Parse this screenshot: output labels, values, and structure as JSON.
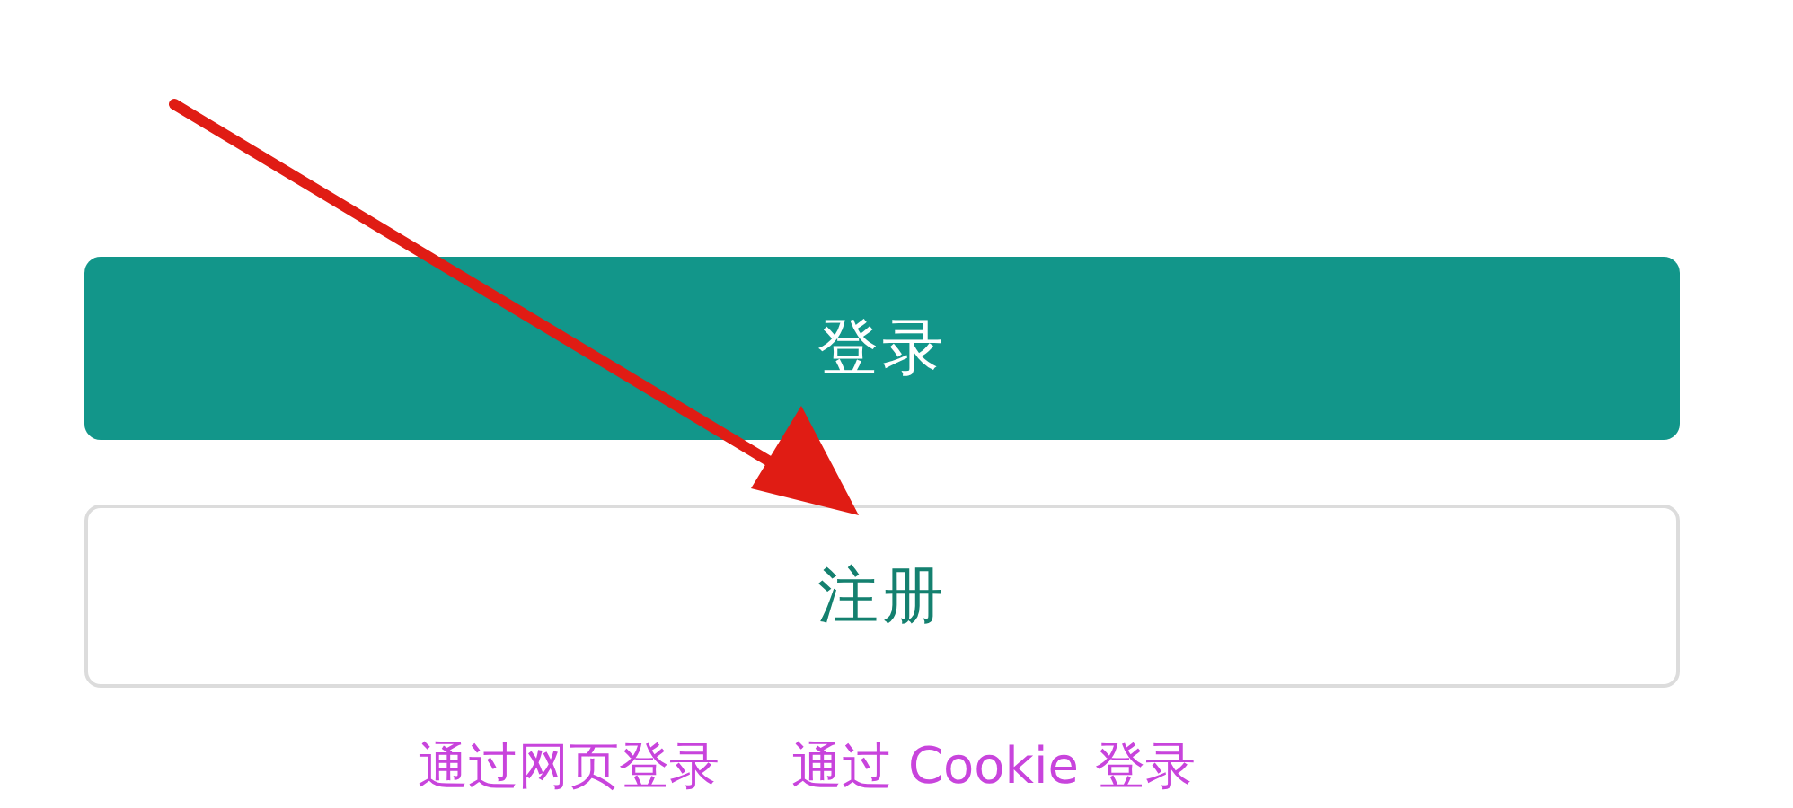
{
  "buttons": [
    {
      "label": "登录",
      "kind": "primary"
    },
    {
      "label": "注册",
      "kind": "secondary"
    }
  ],
  "links": [
    "通过网页登录",
    "通过 Cookie 登录"
  ]
}
